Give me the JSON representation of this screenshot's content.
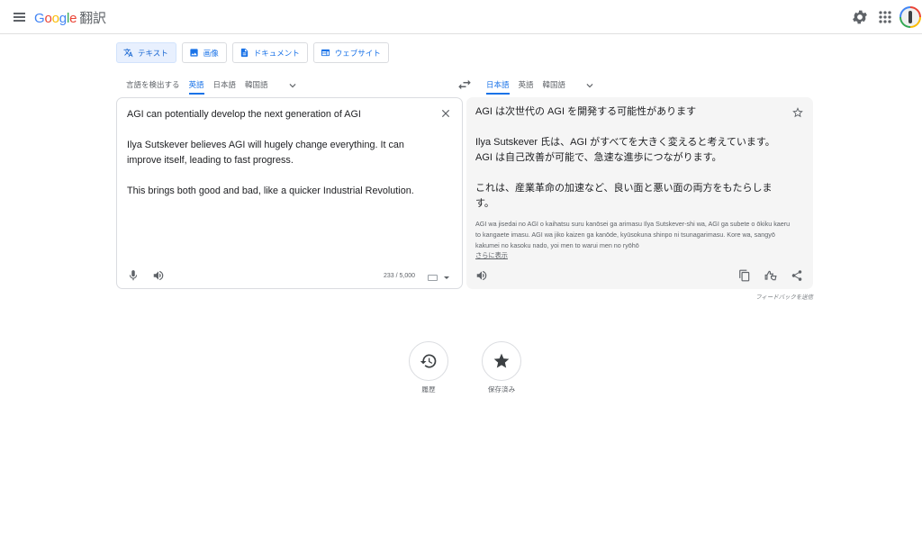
{
  "header": {
    "logo": {
      "G": "G",
      "o1": "o",
      "o2": "o",
      "g": "g",
      "l": "l",
      "e": "e"
    },
    "product_name": "翻訳",
    "icons": [
      "menu-icon",
      "gear-icon",
      "apps-grid-icon",
      "account-avatar"
    ]
  },
  "modes": [
    {
      "label": "テキスト",
      "icon": "translate-icon",
      "active": true
    },
    {
      "label": "画像",
      "icon": "image-icon",
      "active": false
    },
    {
      "label": "ドキュメント",
      "icon": "document-icon",
      "active": false
    },
    {
      "label": "ウェブサイト",
      "icon": "website-icon",
      "active": false
    }
  ],
  "source_langs": [
    "言語を検出する",
    "英語",
    "日本語",
    "韓国語"
  ],
  "target_langs": [
    "日本語",
    "英語",
    "韓国語"
  ],
  "source_text": "AGI can potentially develop the next generation of AGI\n\nIlya Sutskever believes AGI will hugely change everything. It can improve itself, leading to fast progress.\n\nThis brings both good and bad, like a quicker Industrial Revolution.",
  "target_text": "AGI は次世代の AGI を開発する可能性があります\n\nIlya Sutskever 氏は、AGI がすべてを大きく変えると考えています。AGI は自己改善が可能で、急速な進歩につながります。\n\nこれは、産業革命の加速など、良い面と悪い面の両方をもたらします。",
  "romanization": "AGI wa jisedai no AGI o kaihatsu suru kanōsei ga arimasu Ilya Sutskever-shi wa, AGI ga subete o ōkiku kaeru to kangaete imasu. AGI wa jiko kaizen ga kanōde, kyūsokuna shinpo ni tsunagarimasu. Kore wa, sangyō kakumei no kasoku nado, yoi men to warui men no ryōhō",
  "show_more": "さらに表示",
  "char_count": "233 / 5,000",
  "feedback": "フィードバックを送信",
  "bottom": {
    "history": "履歴",
    "saved": "保存済み"
  },
  "colors": {
    "accent": "#1a73e8",
    "active_bg": "#e8f0fe",
    "target_bg": "#f5f5f5",
    "border": "#dadce0"
  }
}
